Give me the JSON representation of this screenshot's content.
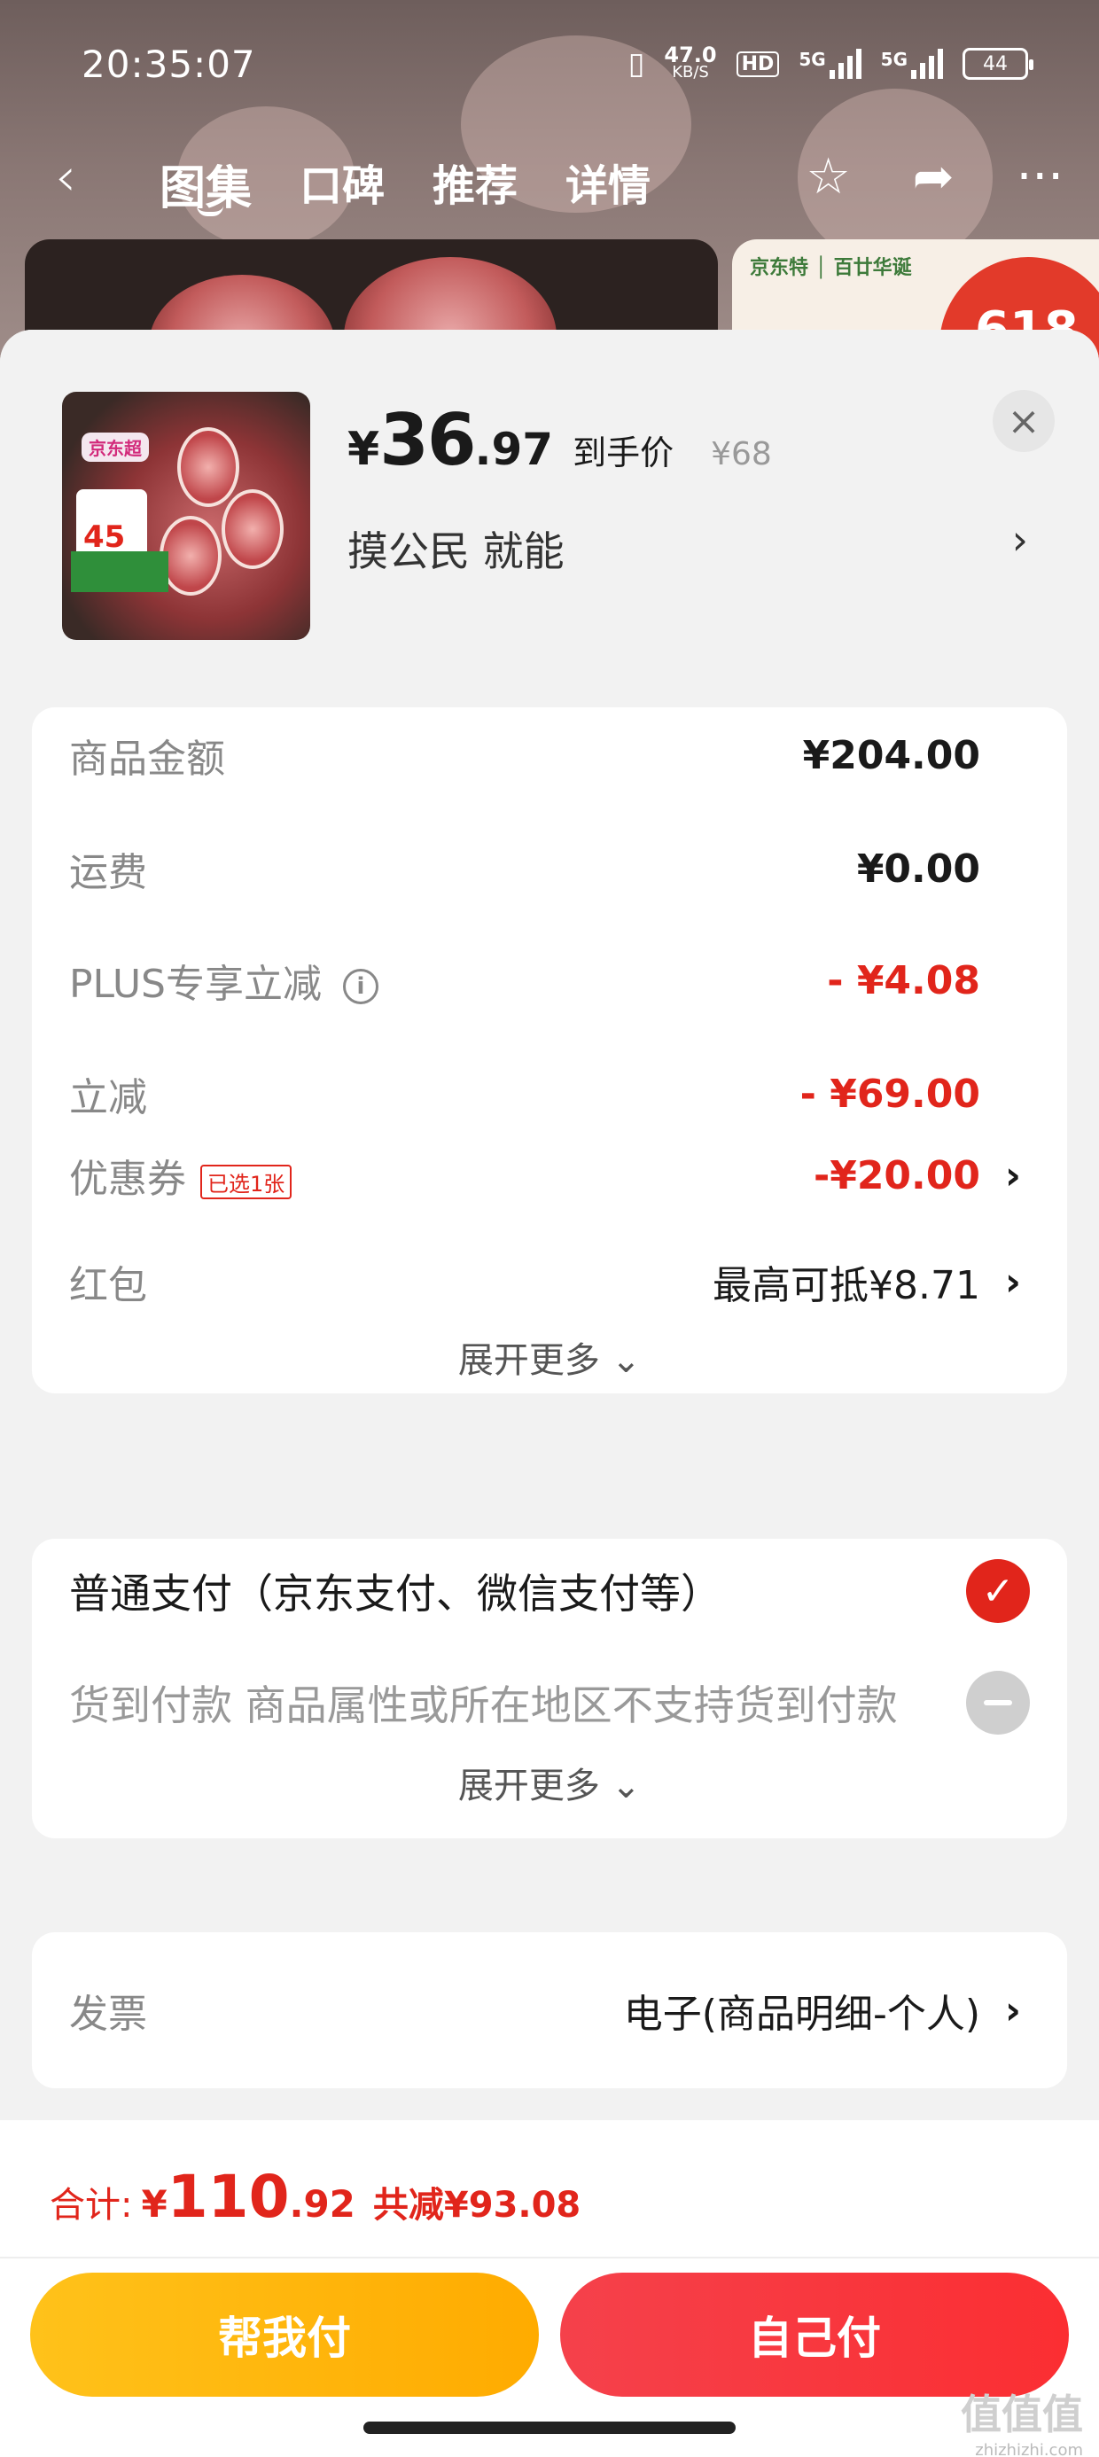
{
  "status_bar": {
    "time": "20:35:07",
    "net_speed_value": "47.0",
    "net_speed_unit": "KB/S",
    "hd": "HD",
    "sig1": "5G",
    "sig2": "5G",
    "battery": "44"
  },
  "nav": {
    "back_icon": "chevron-left-icon",
    "tabs": [
      {
        "label": "图集",
        "active": true
      },
      {
        "label": "口碑"
      },
      {
        "label": "推荐"
      },
      {
        "label": "详情"
      }
    ],
    "favorite_icon": "star-icon",
    "share_icon": "share-icon",
    "more_icon": "more-icon"
  },
  "background_cards": {
    "right_brand": "京东特 │ 百廿华诞",
    "badge": "618"
  },
  "product": {
    "thumb_tag": "京东超",
    "thumb_price": "45",
    "price_yen": "¥",
    "price_int": "36",
    "price_dec": ".97",
    "price_label": "到手价",
    "original_price": "¥68",
    "sku": "摸公民  就能",
    "close_icon": "close-icon"
  },
  "summary": {
    "rows": [
      {
        "label": "商品金额",
        "value": "¥204.00"
      },
      {
        "label": "运费",
        "value": "¥0.00"
      },
      {
        "label": "PLUS专享立减",
        "value": "- ¥4.08"
      },
      {
        "label": "立减",
        "value": "- ¥69.00"
      },
      {
        "label": "优惠券",
        "tag": "已选1张",
        "value": "-¥20.00"
      },
      {
        "label": "红包",
        "value": "最高可抵¥8.71"
      }
    ],
    "expand": "展开更多"
  },
  "payment": {
    "options": [
      {
        "label": "普通支付（京东支付、微信支付等）",
        "selected": true
      },
      {
        "label": "货到付款 商品属性或所在地区不支持货到付款",
        "selected": false
      }
    ],
    "expand": "展开更多"
  },
  "invoice": {
    "label": "发票",
    "value": "电子(商品明细-个人)"
  },
  "footer": {
    "total_label": "合计:",
    "total_yen": "¥",
    "total_int": "110",
    "total_dec": ".92",
    "saved": "共减¥93.08",
    "friend_pay": "帮我付",
    "self_pay": "自己付",
    "watermark": "值值值",
    "watermark_sub": "zhizhizhi.com"
  },
  "colors": {
    "accent": "#e1251b",
    "friend_button": "#ffb400",
    "self_button": "#f73a3f"
  }
}
